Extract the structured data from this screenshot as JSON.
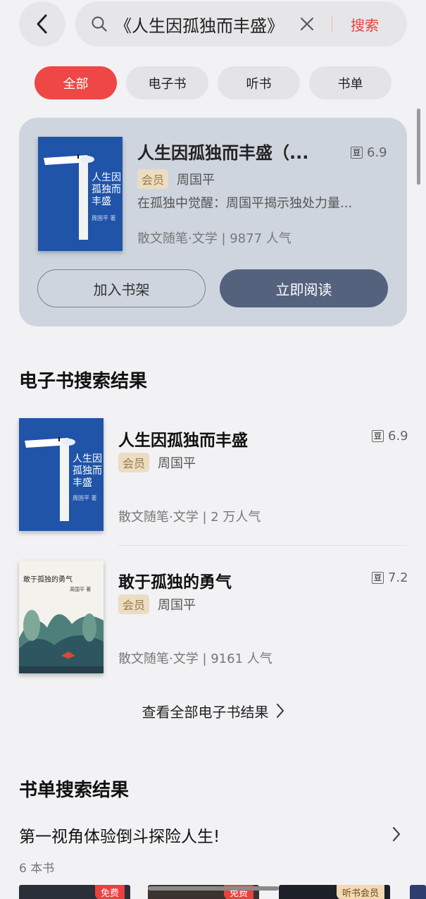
{
  "search": {
    "query": "《人生因孤独而丰盛》",
    "submit_label": "搜索"
  },
  "filters": [
    {
      "label": "全部",
      "active": true
    },
    {
      "label": "电子书",
      "active": false
    },
    {
      "label": "听书",
      "active": false
    },
    {
      "label": "书单",
      "active": false
    }
  ],
  "hero": {
    "title": "人生因孤独而丰盛（...",
    "rating": "6.9",
    "douban_icon": "豆",
    "vip_label": "会员",
    "author": "周国平",
    "description": "在孤独中觉醒：周国平揭示独处力量...",
    "meta": "散文随笔·文学 | 9877 人气",
    "cover_title": "人生因孤独而丰盛",
    "cover_author": "周国平 著",
    "add_shelf_label": "加入书架",
    "read_now_label": "立即阅读"
  },
  "ebook_section": {
    "title": "电子书搜索结果",
    "items": [
      {
        "title": "人生因孤独而丰盛",
        "rating": "6.9",
        "vip_label": "会员",
        "author": "周国平",
        "meta": "散文随笔·文学 | 2 万人气",
        "cover_title": "人生因孤独而丰盛",
        "cover_author": "周国平 著"
      },
      {
        "title": "敢于孤独的勇气",
        "rating": "7.2",
        "vip_label": "会员",
        "author": "周国平",
        "meta": "散文随笔·文学 | 9161 人气",
        "cover_title": "敢于孤独的勇气",
        "cover_author": "周国平 著"
      }
    ],
    "view_all_label": "查看全部电子书结果"
  },
  "booklist_section": {
    "title": "书单搜索结果",
    "list_title": "第一视角体验倒斗探险人生!",
    "count": "6 本书",
    "thumb_tags": [
      "免费",
      "免费",
      "听书会员"
    ]
  },
  "colors": {
    "accent_red": "#ef4746",
    "read_button": "#55627e",
    "cover_blue": "#1f54a8"
  }
}
